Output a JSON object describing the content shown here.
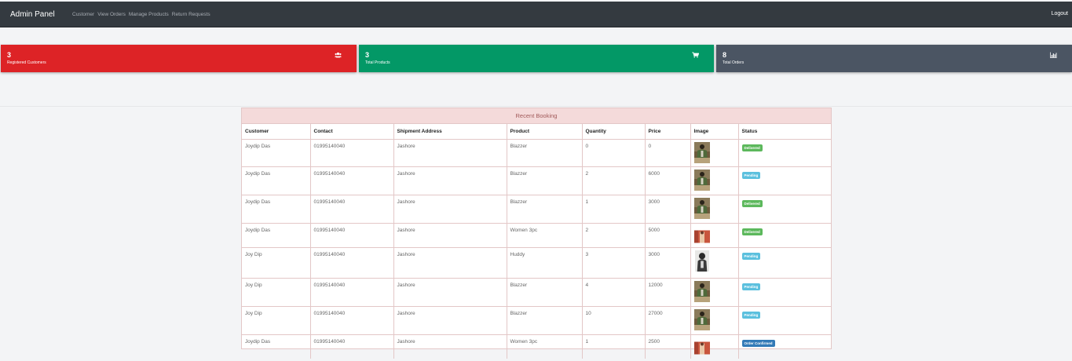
{
  "navbar": {
    "brand": "Admin Panel",
    "links": [
      "Customer",
      "View Orders",
      "Manage Products",
      "Return Requests"
    ],
    "logout": "Logout"
  },
  "cards": [
    {
      "value": "3",
      "label": "Registered Customers",
      "color": "#dd2326",
      "icon": "users-icon"
    },
    {
      "value": "3",
      "label": "Total Products",
      "color": "#039866",
      "icon": "cart-icon"
    },
    {
      "value": "8",
      "label": "Total Orders",
      "color": "#4b5563",
      "icon": "bar-chart-icon"
    }
  ],
  "table": {
    "caption": "Recent Booking",
    "headers": [
      "Customer",
      "Contact",
      "Shipment Address",
      "Product",
      "Quantity",
      "Price",
      "Image",
      "Status"
    ],
    "rows": [
      {
        "customer": "Joydip Das",
        "contact": "01995140040",
        "address": "Jashore",
        "product": "Blazzer",
        "quantity": "0",
        "price": "0",
        "image": "blazzer-photo",
        "status": "Delivered"
      },
      {
        "customer": "Joydip Das",
        "contact": "01995140040",
        "address": "Jashore",
        "product": "Blazzer",
        "quantity": "2",
        "price": "6000",
        "image": "blazzer-photo",
        "status": "Pending"
      },
      {
        "customer": "Joydip Das",
        "contact": "01995140040",
        "address": "Jashore",
        "product": "Blazzer",
        "quantity": "1",
        "price": "3000",
        "image": "blazzer-photo",
        "status": "Delivered"
      },
      {
        "customer": "Joydip Das",
        "contact": "01995140040",
        "address": "Jashore",
        "product": "Women 3pc",
        "quantity": "2",
        "price": "5000",
        "image": "women-3pc-photo",
        "status": "Delivered"
      },
      {
        "customer": "Joy Dip",
        "contact": "01995140040",
        "address": "Jashore",
        "product": "Huddy",
        "quantity": "3",
        "price": "3000",
        "image": "huddy-photo",
        "status": "Pending"
      },
      {
        "customer": "Joy Dip",
        "contact": "01995140040",
        "address": "Jashore",
        "product": "Blazzer",
        "quantity": "4",
        "price": "12000",
        "image": "blazzer-photo",
        "status": "Pending"
      },
      {
        "customer": "Joy Dip",
        "contact": "01995140040",
        "address": "Jashore",
        "product": "Blazzer",
        "quantity": "10",
        "price": "27000",
        "image": "blazzer-photo",
        "status": "Pending"
      },
      {
        "customer": "Joydip Das",
        "contact": "01995140040",
        "address": "Jashore",
        "product": "Women 3pc",
        "quantity": "1",
        "price": "2500",
        "image": "women-3pc-photo",
        "status": "Order Confirmed"
      }
    ]
  },
  "status_colors": {
    "Delivered": "#5cb85c",
    "Pending": "#5bc0de",
    "Order Confirmed": "#337ab7"
  }
}
